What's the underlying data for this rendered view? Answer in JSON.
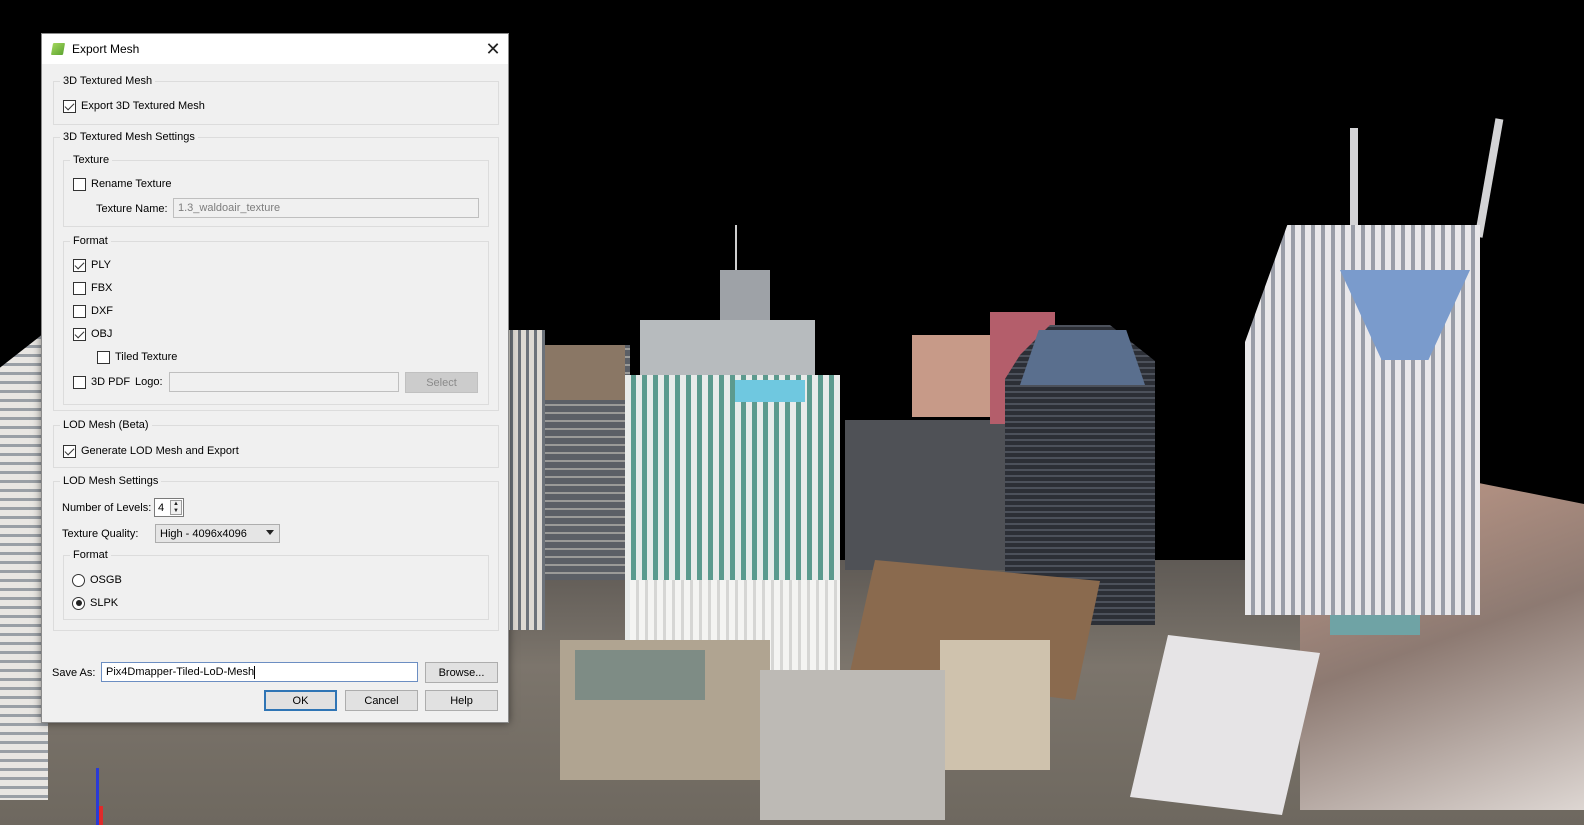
{
  "dialog": {
    "title": "Export Mesh",
    "icon": "pix4d-app-icon",
    "close_icon": "close-icon",
    "textured_mesh": {
      "legend": "3D Textured Mesh",
      "export_label": "Export 3D Textured Mesh",
      "export_checked": true
    },
    "textured_mesh_settings": {
      "legend": "3D Textured Mesh Settings",
      "texture": {
        "legend": "Texture",
        "rename_label": "Rename Texture",
        "rename_checked": false,
        "name_label": "Texture Name:",
        "name_value": "1.3_waldoair_texture"
      },
      "format": {
        "legend": "Format",
        "options": [
          {
            "label": "PLY",
            "checked": true
          },
          {
            "label": "FBX",
            "checked": false
          },
          {
            "label": "DXF",
            "checked": false
          },
          {
            "label": "OBJ",
            "checked": true
          }
        ],
        "tiled_texture_label": "Tiled Texture",
        "tiled_texture_checked": false,
        "pdf_label": "3D PDF",
        "pdf_checked": false,
        "logo_label": "Logo:",
        "logo_value": "",
        "select_label": "Select"
      }
    },
    "lod_mesh": {
      "legend": "LOD Mesh (Beta)",
      "generate_label": "Generate LOD Mesh and Export",
      "generate_checked": true
    },
    "lod_settings": {
      "legend": "LOD Mesh Settings",
      "levels_label": "Number of Levels:",
      "levels_value": "4",
      "quality_label": "Texture Quality:",
      "quality_value": "High - 4096x4096",
      "format": {
        "legend": "Format",
        "options": [
          {
            "label": "OSGB",
            "selected": false
          },
          {
            "label": "SLPK",
            "selected": true
          }
        ]
      }
    },
    "save_as": {
      "label": "Save As:",
      "value": "Pix4Dmapper-Tiled-LoD-Mesh",
      "browse_label": "Browse..."
    },
    "buttons": {
      "ok": "OK",
      "cancel": "Cancel",
      "help": "Help"
    }
  },
  "scene": {
    "description": "3D textured city mesh (downtown aerial view)",
    "axis_colors": {
      "z": "#2a3ad6",
      "x": "#e02a2a"
    }
  }
}
